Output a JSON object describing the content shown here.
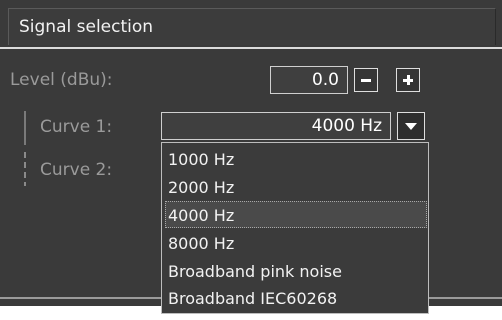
{
  "panel": {
    "title": "Signal selection"
  },
  "level": {
    "label": "Level (dBu):",
    "value": "0.0",
    "decrement_icon": "minus-icon",
    "increment_icon": "plus-icon"
  },
  "curve1": {
    "label": "Curve 1:",
    "selected_value": "4000 Hz",
    "dropdown_icon": "chevron-down-icon"
  },
  "curve2": {
    "label": "Curve 2:"
  },
  "dropdown": {
    "options": [
      "1000 Hz",
      "2000 Hz",
      "4000 Hz",
      "8000 Hz",
      "Broadband pink noise",
      "Broadband IEC60268"
    ],
    "selected_index": 2
  },
  "colors": {
    "panel_bg": "#3a3a3a",
    "text_primary": "#f2f2f2",
    "text_muted": "#9a9a9a",
    "border": "#cfcfcf"
  }
}
